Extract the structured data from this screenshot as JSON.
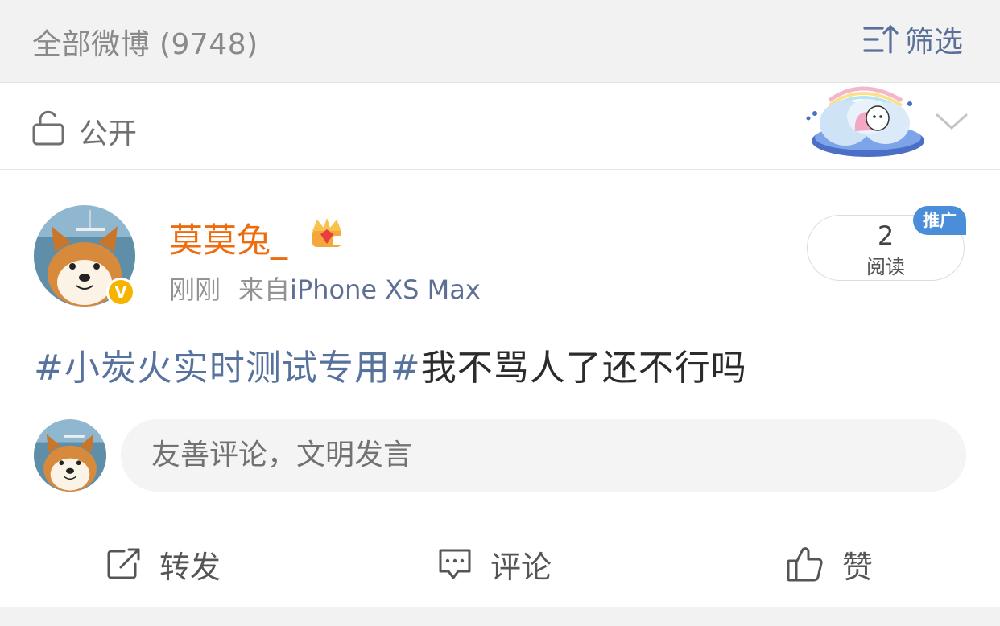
{
  "header": {
    "title": "全部微博 (9748)",
    "filter_label": "筛选"
  },
  "privacy": {
    "label": "公开"
  },
  "post": {
    "username": "莫莫兔_",
    "time": "刚刚",
    "source_prefix": "来自",
    "device": "iPhone XS Max",
    "read_count": "2",
    "read_label": "阅读",
    "promo_badge": "推广",
    "topic": "#小炭火实时测试专用#",
    "text": "我不骂人了还不行吗",
    "verified_badge": "V"
  },
  "comment": {
    "placeholder": "友善评论，文明发言"
  },
  "actions": {
    "repost": "转发",
    "comment": "评论",
    "like": "赞"
  },
  "icons": [
    "sort-filter-icon",
    "unlock-icon",
    "chevron-down-icon",
    "crown-icon",
    "repost-icon",
    "comment-icon",
    "thumbs-up-icon"
  ],
  "colors": {
    "accent_blue": "#58729e",
    "username_orange": "#ee6b0e",
    "badge_yellow": "#f5b400",
    "promo_blue": "#4a8ed9"
  }
}
